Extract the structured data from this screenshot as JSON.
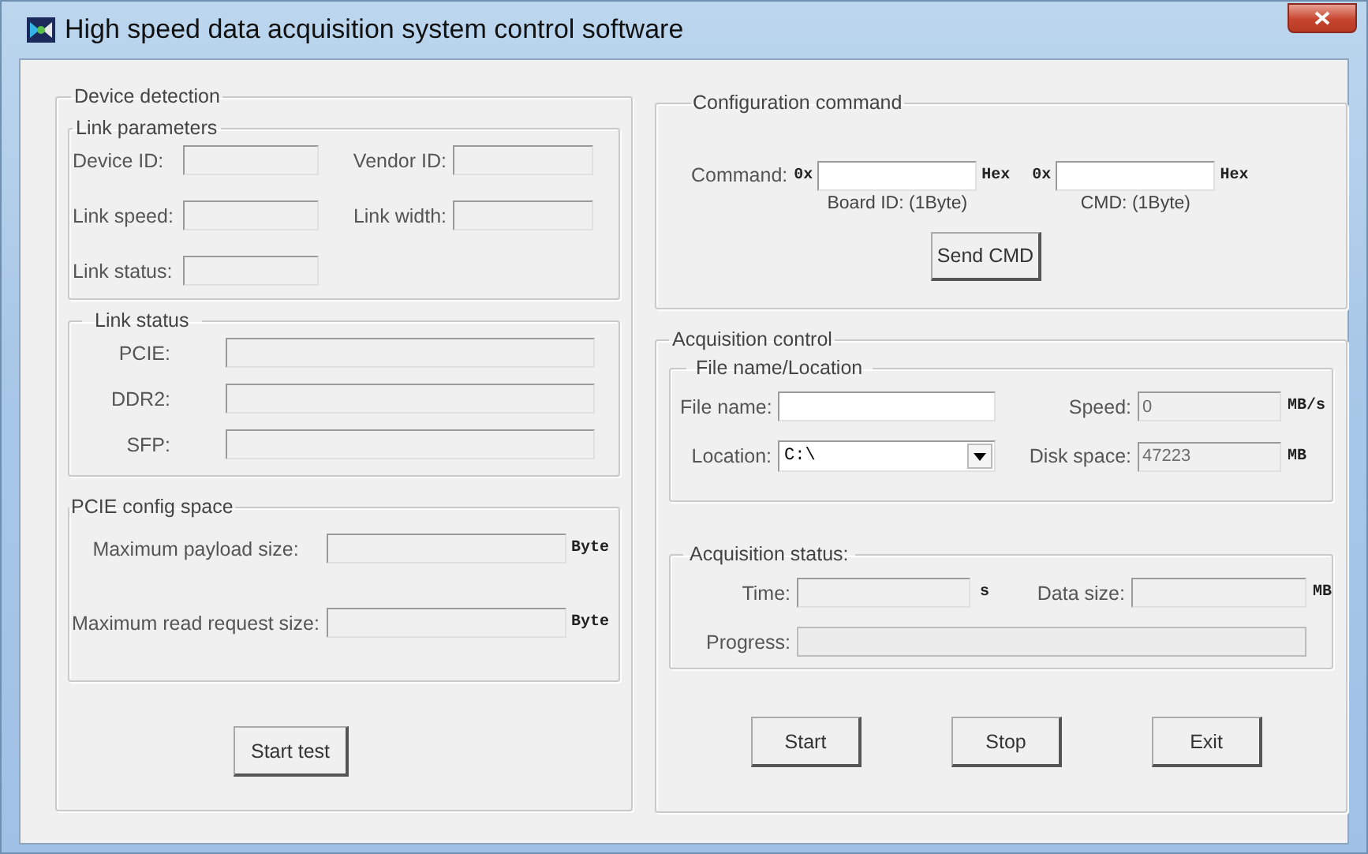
{
  "window": {
    "title": "High speed data acquisition system control software"
  },
  "device_detection": {
    "title": "Device detection",
    "link_parameters": {
      "title": "Link parameters",
      "fields": [
        {
          "label": "Device ID:",
          "disabled": true
        },
        {
          "label": "Vendor ID:",
          "disabled": true
        },
        {
          "label": "Link speed:",
          "disabled": true
        },
        {
          "label": "Link width:",
          "disabled": true
        },
        {
          "label": "Link status:",
          "disabled": true
        }
      ]
    },
    "link_status": {
      "title": "Link status",
      "fields": [
        {
          "label": "PCIE:",
          "disabled": true
        },
        {
          "label": "DDR2:",
          "disabled": true
        },
        {
          "label": "SFP:",
          "disabled": true
        }
      ]
    },
    "pcie_config_space": {
      "title": "PCIE config space",
      "fields": [
        {
          "label": "Maximum payload size:",
          "unit": "Byte",
          "disabled": true
        },
        {
          "label": "Maximum read request size:",
          "unit": "Byte",
          "disabled": true
        }
      ]
    },
    "button": "Start test"
  },
  "configuration_command": {
    "title": "Configuration command",
    "label": "Command:",
    "inputs": [
      {
        "prefix": "0x",
        "unit": "Hex",
        "caption": "Board ID: (1Byte)",
        "disabled": false
      },
      {
        "prefix": "0x",
        "unit": "Hex",
        "caption": "CMD: (1Byte)",
        "disabled": false
      }
    ],
    "button": "Send CMD"
  },
  "acquisition_control": {
    "title": "Acquisition control",
    "file_location": {
      "title": "File name/Location",
      "file_name": {
        "label": "File name:",
        "disabled": false
      },
      "speed": {
        "label": "Speed:",
        "value": "0",
        "unit": "MB/s",
        "disabled": true
      },
      "location": {
        "label": "Location:",
        "value": "C:\\"
      },
      "disk_space": {
        "label": "Disk space:",
        "value": "47223",
        "unit": "MB",
        "disabled": true
      }
    },
    "status": {
      "title": "Acquisition status:",
      "time": {
        "label": "Time:",
        "unit": "s",
        "disabled": true
      },
      "data_size": {
        "label": "Data size:",
        "unit": "MB",
        "disabled": true
      },
      "progress": {
        "label": "Progress:",
        "level": 0
      }
    },
    "buttons": [
      "Start",
      "Stop",
      "Exit"
    ]
  }
}
